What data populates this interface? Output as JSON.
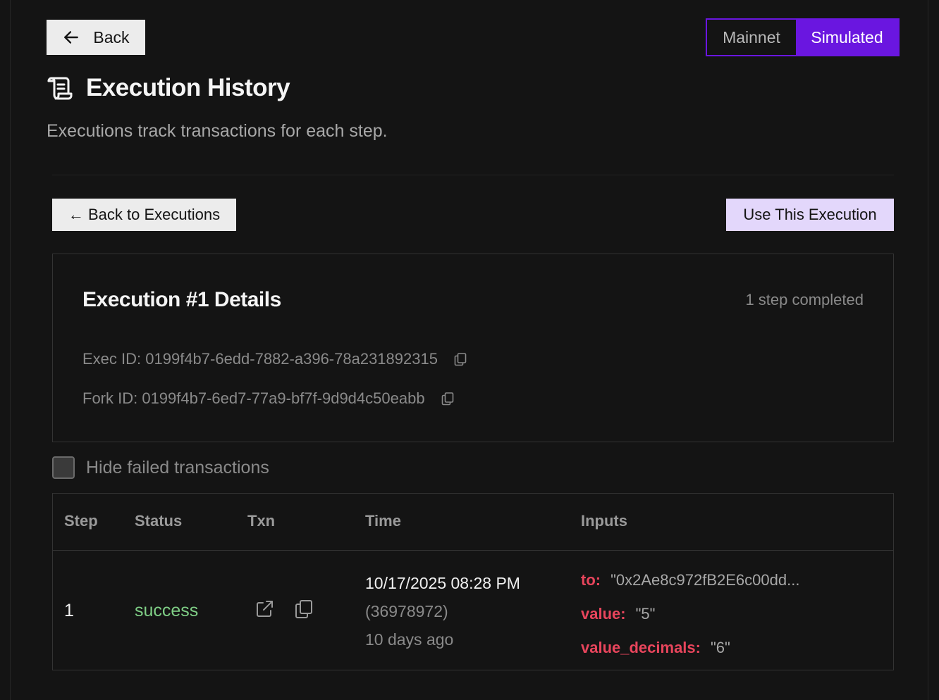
{
  "header": {
    "back_label": "Back",
    "network": {
      "options": [
        "Mainnet",
        "Simulated"
      ],
      "selected": "Simulated"
    },
    "title": "Execution History",
    "subtitle": "Executions track transactions for each step."
  },
  "actions": {
    "back_to_executions": "← Back to Executions",
    "use_execution": "Use This Execution"
  },
  "details": {
    "title": "Execution #1 Details",
    "steps_completed": "1 step completed",
    "exec_id": "Exec ID: 0199f4b7-6edd-7882-a396-78a231892315",
    "fork_id": "Fork ID: 0199f4b7-6ed7-77a9-bf7f-9d9d4c50eabb"
  },
  "filter": {
    "hide_failed_label": "Hide failed transactions",
    "checked": false
  },
  "table": {
    "headers": [
      "Step",
      "Status",
      "Txn",
      "Time",
      "Inputs"
    ],
    "rows": [
      {
        "step": "1",
        "status": "success",
        "time": "10/17/2025 08:28 PM",
        "block": "(36978972)",
        "ago": "10 days ago",
        "inputs": [
          {
            "key": "to:",
            "value": "\"0x2Ae8c972fB2E6c00dd..."
          },
          {
            "key": "value:",
            "value": "\"5\""
          },
          {
            "key": "value_decimals:",
            "value": "\"6\""
          }
        ]
      }
    ]
  },
  "colors": {
    "background": "#141414",
    "accent": "#6a16e0",
    "accent_light": "#e3d7fb",
    "success": "#7fcf86",
    "input_key": "#e8455c"
  },
  "icons": [
    "arrow-left-icon",
    "scroll-icon",
    "copy-icon",
    "external-link-icon"
  ]
}
